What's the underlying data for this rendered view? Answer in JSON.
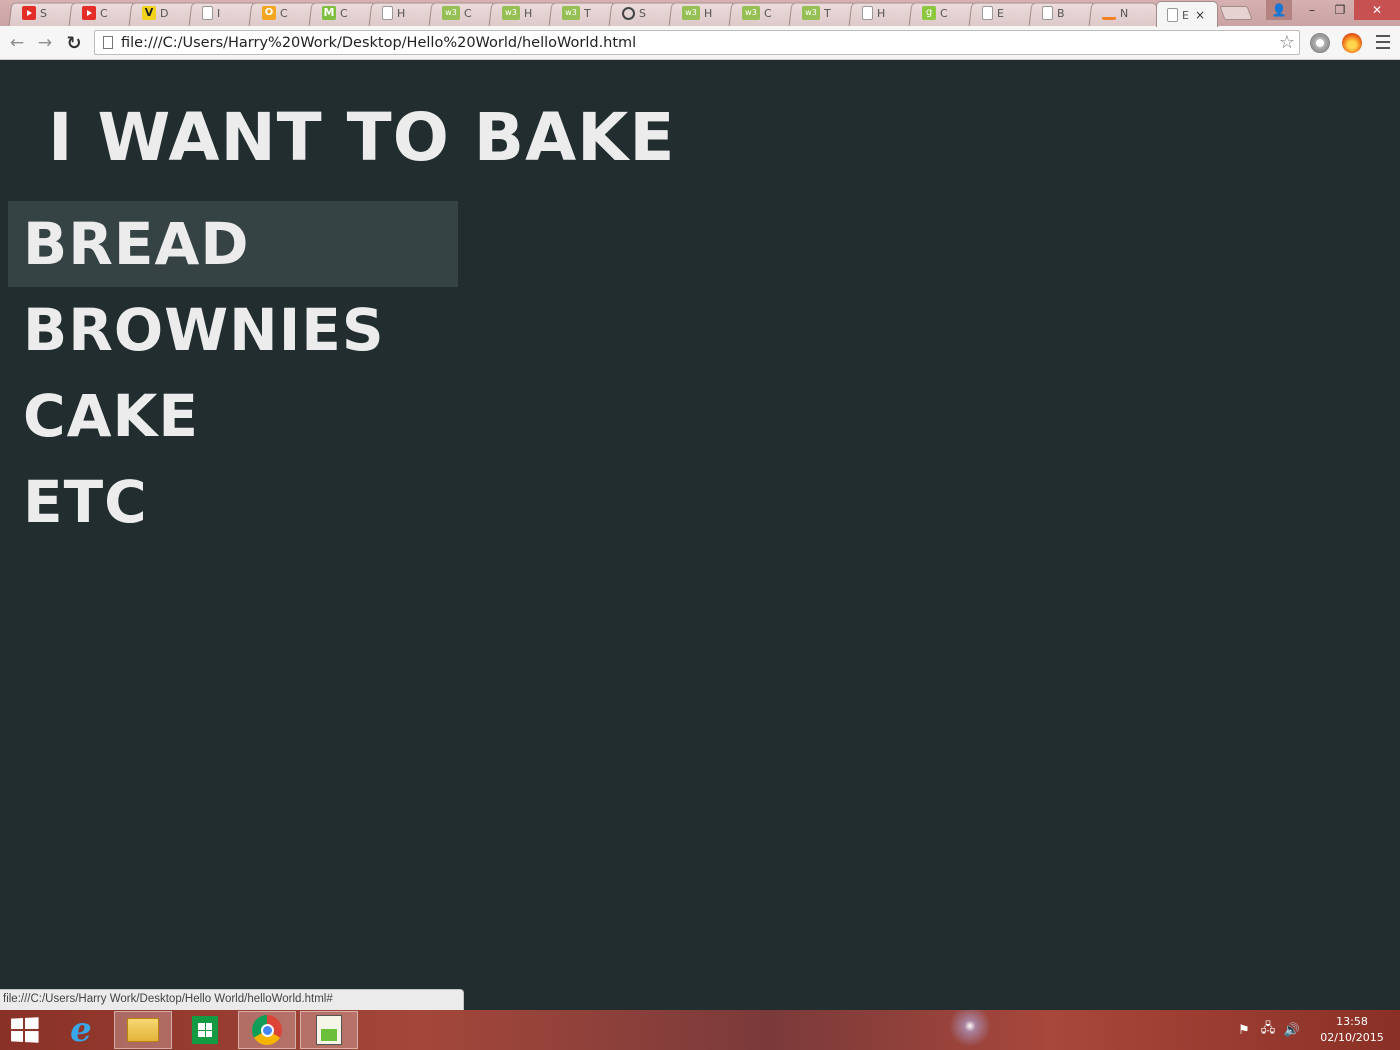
{
  "browser": {
    "tabs": [
      {
        "icon": "youtube-icon",
        "label": "S"
      },
      {
        "icon": "youtube-icon",
        "label": "C"
      },
      {
        "icon": "v-logo-icon",
        "label": "D"
      },
      {
        "icon": "document-icon",
        "label": "I"
      },
      {
        "icon": "o-logo-icon",
        "label": "C"
      },
      {
        "icon": "m-logo-icon",
        "label": "C"
      },
      {
        "icon": "document-icon",
        "label": "H"
      },
      {
        "icon": "w3schools-icon",
        "label": "C"
      },
      {
        "icon": "w3schools-icon",
        "label": "H"
      },
      {
        "icon": "w3schools-icon",
        "label": "T"
      },
      {
        "icon": "codepen-icon",
        "label": "S"
      },
      {
        "icon": "w3schools-icon",
        "label": "H"
      },
      {
        "icon": "w3schools-icon",
        "label": "C"
      },
      {
        "icon": "w3schools-icon",
        "label": "T"
      },
      {
        "icon": "document-icon",
        "label": "H"
      },
      {
        "icon": "g-logo-icon",
        "label": "C"
      },
      {
        "icon": "document-icon",
        "label": "E"
      },
      {
        "icon": "document-icon",
        "label": "B"
      },
      {
        "icon": "stackoverflow-icon",
        "label": "N"
      }
    ],
    "active_tab": {
      "icon": "document-icon",
      "label": "E",
      "close": "×"
    },
    "window_controls": {
      "user": "👤",
      "minimize": "–",
      "maximize": "❐",
      "close": "✕"
    },
    "nav": {
      "back": "←",
      "forward": "→",
      "reload": "↻"
    },
    "url": "file:///C:/Users/Harry%20Work/Desktop/Hello%20World/helloWorld.html",
    "star": "☆"
  },
  "page": {
    "heading": "I WANT TO BAKE",
    "items": [
      {
        "label": "BREAD",
        "hovered": true
      },
      {
        "label": "BROWNIES",
        "hovered": false
      },
      {
        "label": "CAKE",
        "hovered": false
      },
      {
        "label": "ETC",
        "hovered": false
      }
    ],
    "colors": {
      "background": "#212d2e",
      "hover": "#364345",
      "text": "#ececec"
    }
  },
  "status_bar": {
    "text": "file:///C:/Users/Harry Work/Desktop/Hello World/helloWorld.html#"
  },
  "taskbar": {
    "pinned": [
      "internet-explorer-icon",
      "file-explorer-icon",
      "windows-store-icon",
      "chrome-icon",
      "notepad-plus-plus-icon"
    ],
    "tray": {
      "flag": "⚑",
      "network": "🖧",
      "volume": "🔊"
    },
    "clock": {
      "time": "13:58",
      "date": "02/10/2015"
    }
  }
}
